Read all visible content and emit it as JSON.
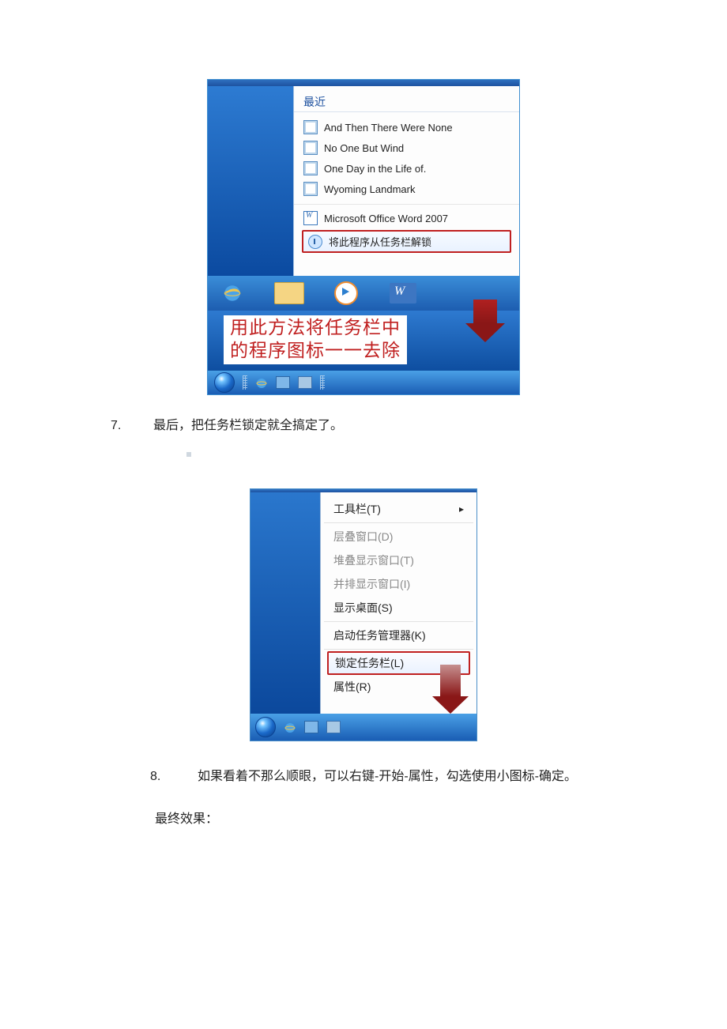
{
  "fig1": {
    "panel_title": "最近",
    "recent": [
      "And Then There Were None",
      "No One But Wind",
      "One Day in the Life of.",
      "Wyoming Landmark"
    ],
    "app_name": "Microsoft Office Word 2007",
    "unpin_label": "将此程序从任务栏解锁",
    "annotation_line1": "用此方法将任务栏中",
    "annotation_line2": "的程序图标一一去除"
  },
  "step7": {
    "num": "7.",
    "text": "最后，把任务栏锁定就全搞定了。"
  },
  "fig2": {
    "menu": {
      "toolbars": "工具栏(T)",
      "cascade": "层叠窗口(D)",
      "stack": "堆叠显示窗口(T)",
      "sidebyside": "并排显示窗口(I)",
      "show_desktop": "显示桌面(S)",
      "task_manager": "启动任务管理器(K)",
      "lock_taskbar": "锁定任务栏(L)",
      "properties": "属性(R)"
    }
  },
  "step8": {
    "num": "8.",
    "text": "如果看着不那么顺眼，可以右键-开始-属性，勾选使用小图标-确定。"
  },
  "final_label": "最终效果："
}
